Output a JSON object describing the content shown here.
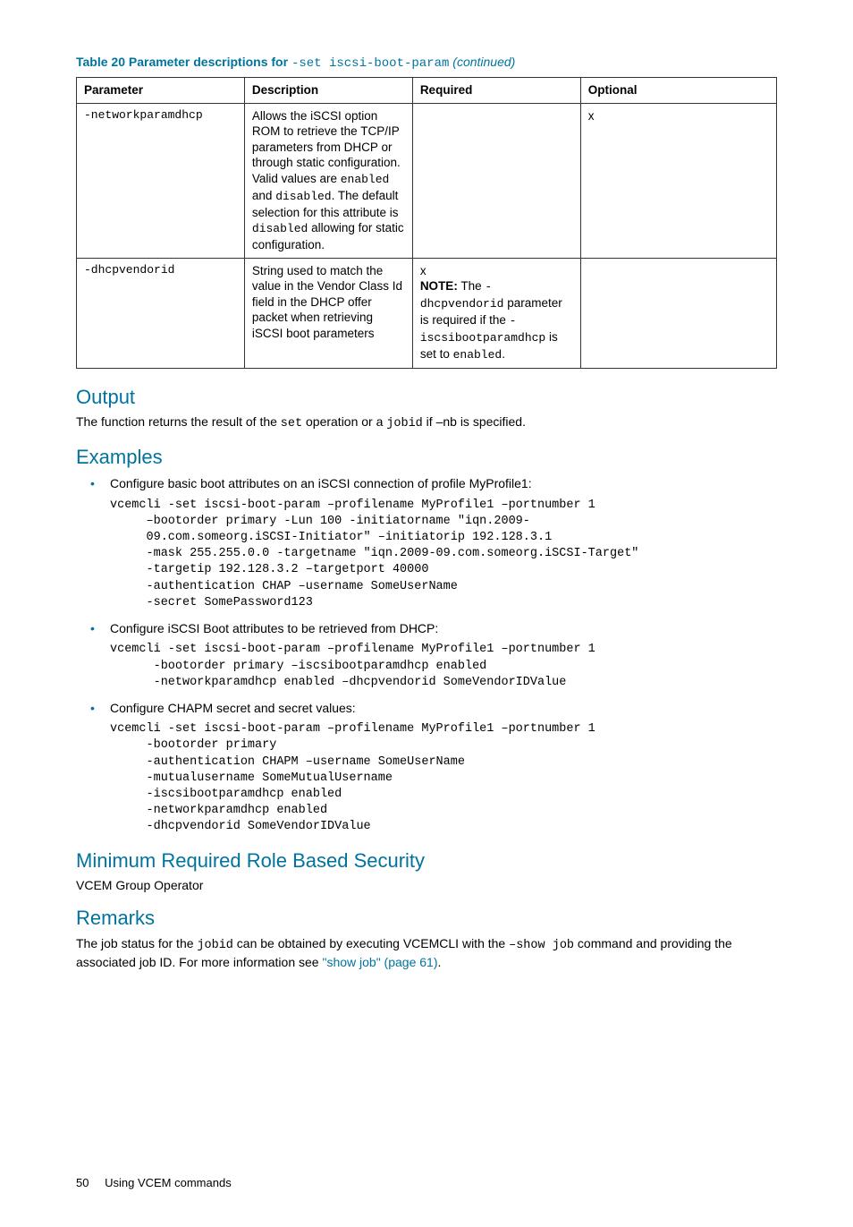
{
  "table": {
    "caption_prefix": "Table 20 Parameter descriptions for ",
    "caption_cmd": "-set iscsi-boot-param",
    "caption_suffix": " (continued)",
    "headers": {
      "param": "Parameter",
      "desc": "Description",
      "req": "Required",
      "opt": "Optional"
    },
    "row1": {
      "param": "-networkparamdhcp",
      "desc_a": "Allows the iSCSI option ROM to retrieve the TCP/IP parameters from DHCP or through static configuration. Valid values are ",
      "desc_en": "enabled",
      "desc_b": " and ",
      "desc_dis": "disabled",
      "desc_c": ". The default selection for this attribute is ",
      "desc_dis2": "disabled",
      "desc_d": " allowing for static configuration.",
      "opt": "x"
    },
    "row2": {
      "param": "-dhcpvendorid",
      "desc": "String used to match the value in the Vendor Class Id field in the DHCP offer packet when retrieving iSCSI boot parameters",
      "req_x": "x",
      "note_label": "NOTE:",
      "note_a": "   The ",
      "note_cmd1": "-dhcpvendorid",
      "note_b": " parameter is required if the ",
      "note_cmd2": "-iscsibootparamdhcp",
      "note_c": " is set to ",
      "note_cmd3": "enabled",
      "note_d": "."
    }
  },
  "output": {
    "heading": "Output",
    "text_a": "The function returns the result of the ",
    "text_set": "set",
    "text_b": " operation or a ",
    "text_jobid": "jobid",
    "text_c": " if –nb is specified."
  },
  "examples": {
    "heading": "Examples",
    "e1_text": "Configure basic boot attributes on an iSCSI connection of profile MyProfile1:",
    "e1_code": "vcemcli -set iscsi-boot-param –profilename MyProfile1 –portnumber 1\n     –bootorder primary -Lun 100 -initiatorname \"iqn.2009-\n     09.com.someorg.iSCSI-Initiator\" –initiatorip 192.128.3.1\n     -mask 255.255.0.0 -targetname \"iqn.2009-09.com.someorg.iSCSI-Target\"\n     -targetip 192.128.3.2 –targetport 40000\n     -authentication CHAP –username SomeUserName\n     -secret SomePassword123",
    "e2_text": "Configure iSCSI Boot attributes to be retrieved from DHCP:",
    "e2_code": "vcemcli -set iscsi-boot-param –profilename MyProfile1 –portnumber 1\n      -bootorder primary –iscsibootparamdhcp enabled\n      -networkparamdhcp enabled –dhcpvendorid SomeVendorIDValue",
    "e3_text": "Configure CHAPM secret and secret values:",
    "e3_code": "vcemcli -set iscsi-boot-param –profilename MyProfile1 –portnumber 1\n     -bootorder primary\n     -authentication CHAPM –username SomeUserName\n     -mutualusername SomeMutualUsername\n     -iscsibootparamdhcp enabled\n     -networkparamdhcp enabled\n     -dhcpvendorid SomeVendorIDValue"
  },
  "security": {
    "heading": "Minimum Required Role Based Security",
    "text": "VCEM Group Operator"
  },
  "remarks": {
    "heading": "Remarks",
    "text_a": "The job status for the ",
    "text_jobid": "jobid",
    "text_b": " can be obtained by executing VCEMCLI with the ",
    "text_show": "–show job",
    "text_c": " command and providing the associated job ID. For more information see ",
    "link": "\"show job\" (page 61)",
    "text_d": "."
  },
  "footer": {
    "page": "50",
    "title": "Using VCEM commands"
  }
}
